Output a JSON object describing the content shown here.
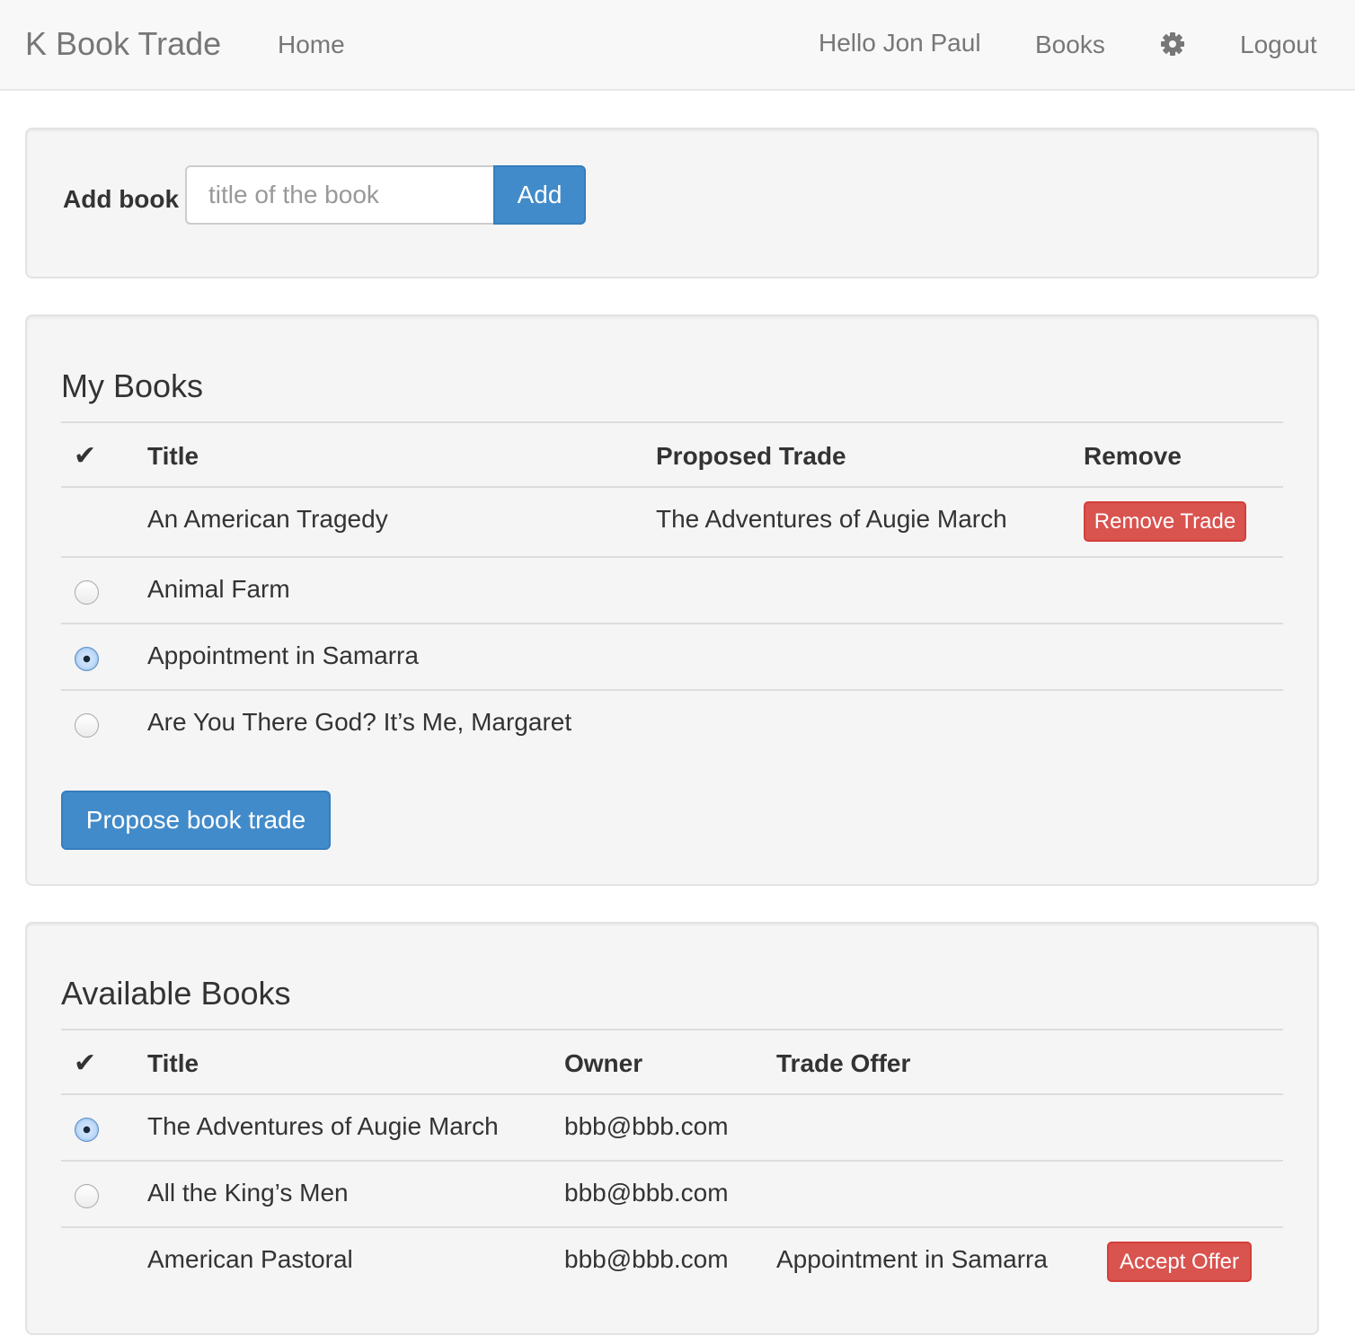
{
  "navbar": {
    "brand": "K Book Trade",
    "home": "Home",
    "greeting": "Hello Jon Paul",
    "books": "Books",
    "settings_icon": "gear-icon",
    "logout": "Logout"
  },
  "add_book": {
    "label": "Add book",
    "placeholder": "title of the book",
    "button": "Add"
  },
  "my_books": {
    "title": "My Books",
    "headers": {
      "check": "✔",
      "title": "Title",
      "proposed_trade": "Proposed Trade",
      "remove": "Remove"
    },
    "rows": [
      {
        "title": "An American Tragedy",
        "proposed_trade": "The Adventures of Augie March",
        "action": "Remove Trade",
        "radio": "none"
      },
      {
        "title": "Animal Farm",
        "proposed_trade": "",
        "action": "",
        "radio": "unchecked"
      },
      {
        "title": "Appointment in Samarra",
        "proposed_trade": "",
        "action": "",
        "radio": "checked"
      },
      {
        "title": "Are You There God? It’s Me, Margaret",
        "proposed_trade": "",
        "action": "",
        "radio": "unchecked"
      }
    ],
    "propose_button": "Propose book trade"
  },
  "available_books": {
    "title": "Available Books",
    "headers": {
      "check": "✔",
      "title": "Title",
      "owner": "Owner",
      "trade_offer": "Trade Offer"
    },
    "rows": [
      {
        "title": "The Adventures of Augie March",
        "owner": "bbb@bbb.com",
        "trade_offer": "",
        "action": "",
        "radio": "checked"
      },
      {
        "title": "All the King’s Men",
        "owner": "bbb@bbb.com",
        "trade_offer": "",
        "action": "",
        "radio": "unchecked"
      },
      {
        "title": "American Pastoral",
        "owner": "bbb@bbb.com",
        "trade_offer": "Appointment in Samarra",
        "action": "Accept Offer",
        "radio": "none"
      }
    ]
  },
  "colors": {
    "primary": "#428bca",
    "danger": "#d9534f",
    "navbar_bg": "#f8f8f8",
    "panel_bg": "#f5f5f5"
  }
}
